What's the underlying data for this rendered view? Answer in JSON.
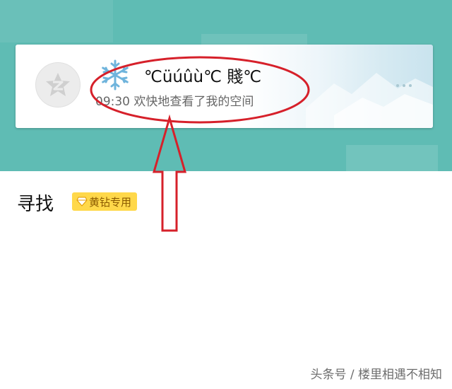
{
  "notification": {
    "title": "℃üúûù℃ 賤℃",
    "time": "09:30",
    "message": "欢快地查看了我的空间"
  },
  "section": {
    "title": "寻找",
    "badge_label": "黄钻专用"
  },
  "watermark": "头条号 / 楼里相遇不相知",
  "colors": {
    "header_bg": "#5fbcb4",
    "annotation_red": "#d6202a",
    "badge_bg": "#ffd84a"
  },
  "icons": {
    "avatar": "qzone-logo-icon",
    "title_prefix": "snowflake-icon",
    "badge_prefix": "diamond-icon"
  }
}
